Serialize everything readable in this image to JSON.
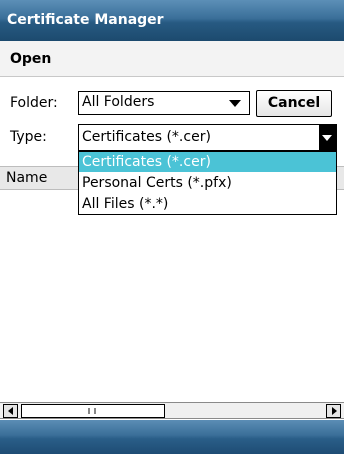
{
  "window": {
    "title": "Certificate Manager"
  },
  "menu": {
    "open_label": "Open"
  },
  "folder": {
    "label": "Folder:",
    "value": "All Folders"
  },
  "cancel_button": {
    "label": "Cancel"
  },
  "type": {
    "label": "Type:",
    "value": "Certificates (*.cer)",
    "options": [
      "Certificates (*.cer)",
      "Personal Certs (*.pfx)",
      "All Files (*.*)"
    ],
    "selected_index": 0
  },
  "list": {
    "columns": [
      "Name"
    ]
  },
  "colors": {
    "accent_selected": "#4bc3d6",
    "titlebar": "#2b5e86"
  }
}
